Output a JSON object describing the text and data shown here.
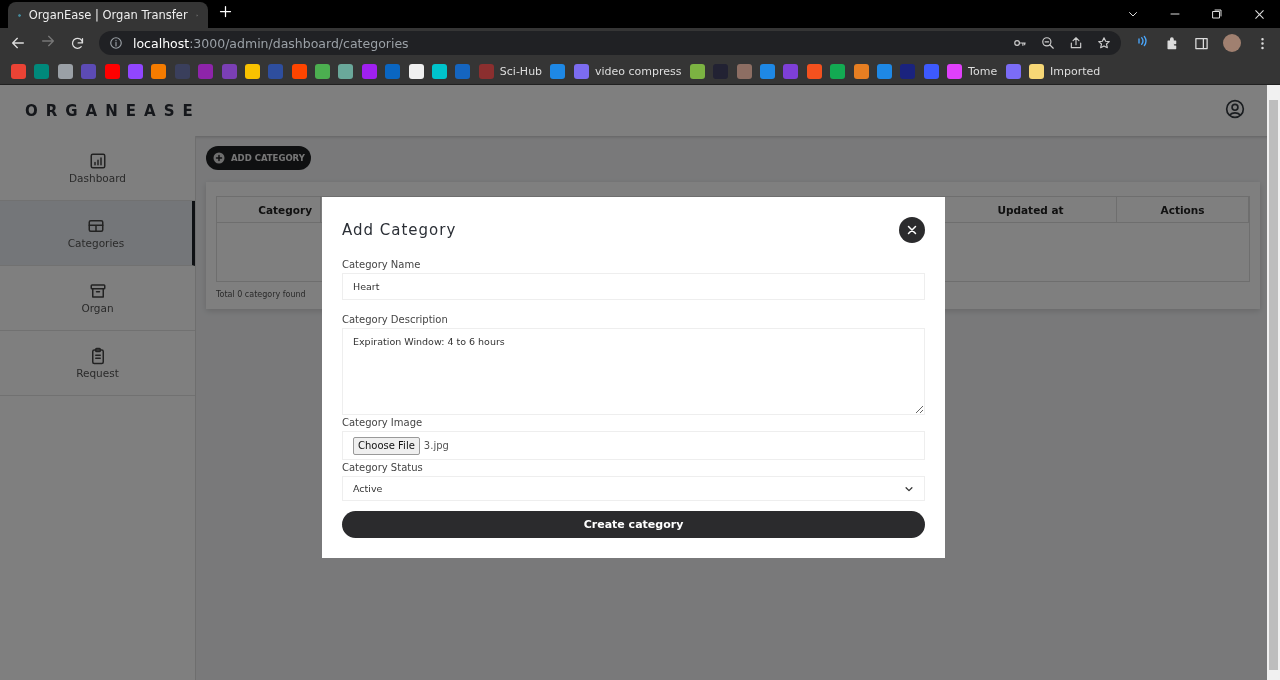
{
  "browser": {
    "tabs": [
      {
        "title": "OrganEase | Organ Transfer",
        "selected": true
      }
    ],
    "url": {
      "host": "localhost",
      "path": ":3000/admin/dashboard/categories"
    },
    "bookmarks": [
      {
        "color": "#ea4335"
      },
      {
        "color": "#00897b"
      },
      {
        "color": "#9aa0a6"
      },
      {
        "color": "#5c4bb5"
      },
      {
        "color": "#ff0000"
      },
      {
        "color": "#9146ff"
      },
      {
        "color": "#f57c00"
      },
      {
        "color": "#3a3f5c"
      },
      {
        "color": "#8e24aa"
      },
      {
        "color": "#7b3fb5"
      },
      {
        "color": "#f9c200"
      },
      {
        "color": "#2e4e9e"
      },
      {
        "color": "#ff4500"
      },
      {
        "color": "#4caf50"
      },
      {
        "color": "#6aa89a"
      },
      {
        "color": "#a020f0"
      },
      {
        "color": "#0a66c2"
      },
      {
        "color": "#f0f0f0"
      },
      {
        "color": "#00c4cc"
      },
      {
        "color": "#1565c0"
      },
      {
        "color": "#8b2f2f",
        "label": "Sci-Hub"
      },
      {
        "color": "#1e88e5"
      },
      {
        "color": "#7c6cf0",
        "label": "video compress"
      },
      {
        "color": "#7cb342"
      },
      {
        "color": "#222233"
      },
      {
        "color": "#8d6e63"
      },
      {
        "color": "#1e88e5"
      },
      {
        "color": "#7e3fd6"
      },
      {
        "color": "#f4511e"
      },
      {
        "color": "#13aa52"
      },
      {
        "color": "#e67e22"
      },
      {
        "color": "#1e88e5"
      },
      {
        "color": "#1a237e"
      },
      {
        "color": "#3d5afe"
      },
      {
        "color": "#e040fb",
        "label": "Tome"
      },
      {
        "color": "#7b6cf6"
      },
      {
        "color": "#f6d776",
        "label": "Imported"
      }
    ]
  },
  "app": {
    "brand": "ORGANEASE",
    "sidebar": {
      "items": [
        {
          "label": "Dashboard",
          "kind": "chart",
          "selected": false
        },
        {
          "label": "Categories",
          "kind": "table",
          "selected": true
        },
        {
          "label": "Organ",
          "kind": "archive",
          "selected": false
        },
        {
          "label": "Request",
          "kind": "clipboard",
          "selected": false
        }
      ]
    },
    "add_button": "ADD CATEGORY",
    "table": {
      "columns": [
        "Category",
        "Updated at",
        "Actions"
      ],
      "footer": "Total 0 category found"
    }
  },
  "modal": {
    "title": "Add Category",
    "fields": [
      {
        "kind": "text",
        "label": "Category Name",
        "value": "Heart"
      },
      {
        "kind": "textarea",
        "label": "Category Description",
        "value": "Expiration Window: 4 to 6 hours"
      },
      {
        "kind": "file",
        "label": "Category Image",
        "button": "Choose File",
        "value": "3.jpg"
      },
      {
        "kind": "select",
        "label": "Category Status",
        "value": "Active"
      }
    ],
    "submit": "Create category"
  }
}
